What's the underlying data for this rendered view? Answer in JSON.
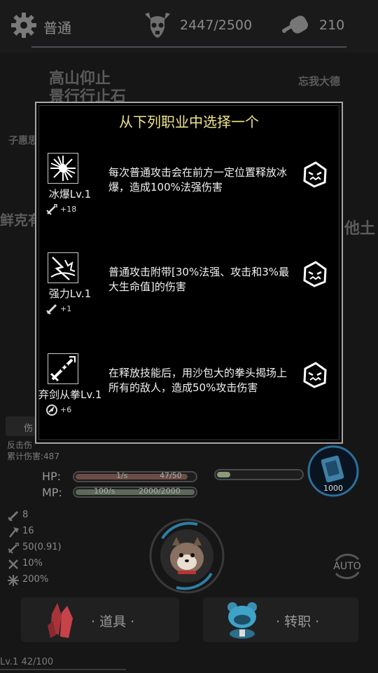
{
  "topbar": {
    "mode_label": "普通",
    "progress_text": "2447/2500",
    "meat_count": "210"
  },
  "background": {
    "title_line1": "高山仰止",
    "title_line2": "景行行止石",
    "right_text_1": "忘我大德",
    "left_text_1": "子惠思",
    "left_text_2": "鲜克有",
    "right_text_2": "他土"
  },
  "dialog": {
    "title": "从下列职业中选择一个",
    "options": [
      {
        "icon": "ice-burst-icon",
        "name": "冰爆Lv.1",
        "stat_icon": "magic-sword-icon",
        "stat": "+18",
        "desc": "每次普通攻击会在前方一定位置释放冰爆，造成100%法强伤害"
      },
      {
        "icon": "power-strike-icon",
        "name": "强力Lv.1",
        "stat_icon": "sword-icon",
        "stat": "+1",
        "desc": "普通攻击附带[30%法强、攻击和3%最大生命值]的伤害"
      },
      {
        "icon": "sword-to-fist-icon",
        "name": "弃剑从拳Lv.1",
        "stat_icon": "crit-icon",
        "stat": "+6",
        "desc": "在释放技能后，用沙包大的拳头揭场上所有的敌人，造成50%攻击伤害"
      }
    ]
  },
  "hud": {
    "dmg_label": "伤",
    "counter_label": "反击伤",
    "total_damage": "累计伤害:487",
    "hp_label": "HP:",
    "hp_rate": "1/s",
    "hp_value": "47/50",
    "mp_label": "MP:",
    "mp_rate": "100/s",
    "mp_value": "2000/2000",
    "hp_fraction": 0.94,
    "mp_fraction": 1.0,
    "exp_fraction": 0.16,
    "skill_count": "1000",
    "stats": [
      {
        "icon": "sword-icon",
        "value": "8"
      },
      {
        "icon": "axe-icon",
        "value": "16"
      },
      {
        "icon": "magic-sword-icon",
        "value": "50(0.91)"
      },
      {
        "icon": "crossed-swords-icon",
        "value": "10%"
      },
      {
        "icon": "burst-icon",
        "value": "200%"
      }
    ],
    "auto_label": "AUTO",
    "items_label": "· 道具 ·",
    "class_label": "· 转职 ·",
    "level_text": "Lv.1   42/100"
  },
  "colors": {
    "title": "#f0e68c",
    "hp_fill": "#6b4d45",
    "mp_fill": "#5b6a5b",
    "exp_fill": "#8a9a7a",
    "accent": "#4aa3c8"
  }
}
